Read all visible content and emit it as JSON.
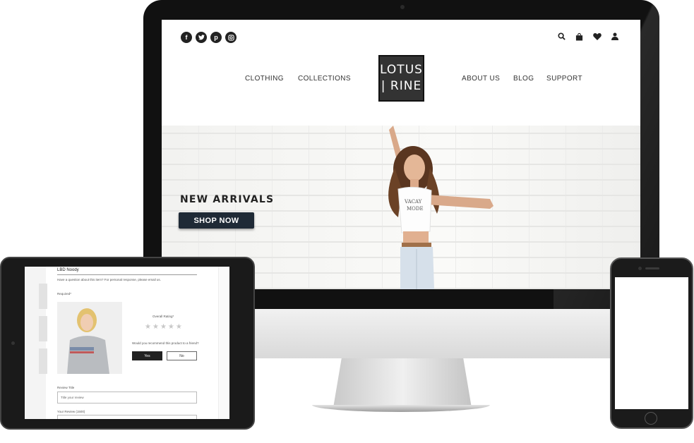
{
  "site": {
    "logo_line1": "LOTUS",
    "logo_line2": "| RINE",
    "nav_left": [
      "CLOTHING",
      "COLLECTIONS"
    ],
    "nav_right": [
      "ABOUT US",
      "BLOG",
      "SUPPORT"
    ],
    "social_icons": [
      "facebook-icon",
      "twitter-icon",
      "pinterest-icon",
      "instagram-icon"
    ],
    "utility_icons": [
      "search-icon",
      "bag-icon",
      "heart-icon",
      "user-icon"
    ],
    "hero": {
      "title": "NEW ARRIVALS",
      "button": "SHOP NOW",
      "tshirt_text": "VACAY MODE"
    }
  },
  "tablet": {
    "product_title": "LBD Noody",
    "question_text": "Have a question about this item? For personal response, please email us.",
    "required_label": "Required*",
    "rating_label": "Overall Rating*",
    "stars": 5,
    "recommend_question": "Would you recommend this product to a friend?",
    "yes_label": "Yes",
    "no_label": "No",
    "review_title_label": "Review Title",
    "review_title_placeholder": "Title your review",
    "review_label": "Your Review (1500)"
  },
  "colors": {
    "button_dark": "#1f2a36",
    "logo_bg": "#333333"
  }
}
